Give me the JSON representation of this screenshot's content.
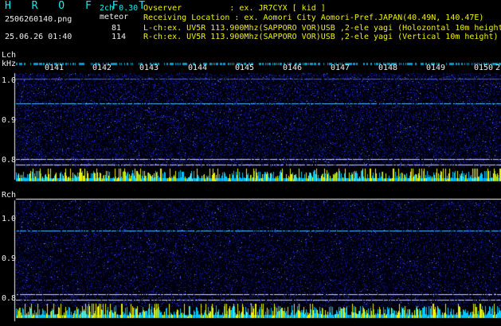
{
  "header": {
    "logo": "H R O F F T",
    "version": "2ch 0.30",
    "filename": "2506260140.png",
    "meteor_label": "meteor",
    "datetime": "25.06.26 01:40",
    "count_l": "81",
    "count_r": "114",
    "observer": "Ovserver          : ex. JR7CYX [ kid ]",
    "location": "Receiving Location : ex. Aomori City Aomori-Pref.JAPAN(40.49N, 140.47E)",
    "lch_info": "L-ch:ex. UV5R 113.900Mhz(SAPPORO VOR)USB ,2-ele yagi (Holozontal 10m height)",
    "rch_info": "R-ch:ex. UV5R 113.900Mhz(SAPPORO VOR)USB ,2-ele yagi (Vertical 10m height)"
  },
  "time_ticks": [
    "0141",
    "0142",
    "0143",
    "0144",
    "0145",
    "0146",
    "0147",
    "0148",
    "0149",
    "0150",
    "2"
  ],
  "lch": {
    "label": "Lch",
    "unit": "kHz",
    "y_ticks": [
      "1.0",
      "0.9",
      "0.8"
    ]
  },
  "rch": {
    "label": "Rch",
    "y_ticks": [
      "1.0",
      "0.9",
      "0.8"
    ]
  },
  "colors": {
    "background": "#000000",
    "noise_blue": "#0a1a8c",
    "signal_line": "#40c0ff",
    "amplitude_yellow": "#f2f200",
    "amplitude_cyan": "#00c8ff",
    "text_yellow": "#f2f200",
    "text_cyan": "#00f2f2"
  }
}
